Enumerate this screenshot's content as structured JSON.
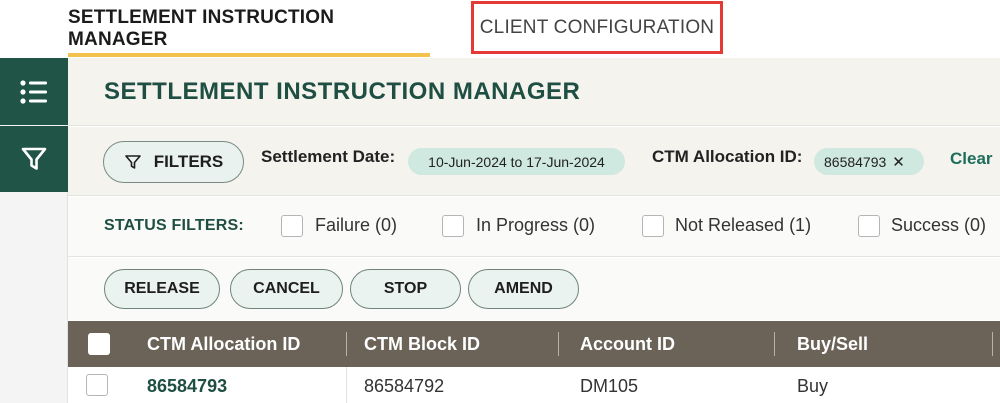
{
  "top_tabs": {
    "active": "SETTLEMENT INSTRUCTION MANAGER",
    "other": "CLIENT CONFIGURATION"
  },
  "sidebar": {
    "items": [
      {
        "icon": "list-icon"
      },
      {
        "icon": "filter-funnel-icon"
      }
    ]
  },
  "main": {
    "title": "SETTLEMENT INSTRUCTION MANAGER"
  },
  "filters": {
    "button_label": "FILTERS",
    "settlement_date_label": "Settlement Date:",
    "settlement_date_value": "10-Jun-2024 to 17-Jun-2024",
    "allocation_label": "CTM Allocation ID:",
    "allocation_value": "86584793",
    "clear_label": "Clear"
  },
  "status_filters": {
    "label": "STATUS FILTERS:",
    "items": [
      {
        "label": "Failure (0)",
        "checked": false
      },
      {
        "label": "In Progress (0)",
        "checked": false
      },
      {
        "label": "Not Released (1)",
        "checked": false
      },
      {
        "label": "Success (0)",
        "checked": false
      }
    ]
  },
  "actions": [
    "RELEASE",
    "CANCEL",
    "STOP",
    "AMEND"
  ],
  "table": {
    "columns": [
      "CTM Allocation ID",
      "CTM Block ID",
      "Account ID",
      "Buy/Sell"
    ],
    "rows": [
      {
        "allocation_id": "86584793",
        "block_id": "86584792",
        "account_id": "DM105",
        "buy_sell": "Buy"
      }
    ]
  },
  "colors": {
    "brand_green": "#1f5446",
    "title_green": "#1f4e43",
    "active_tab_underline": "#f2c14e",
    "highlight_border": "#e53935",
    "chip_bg": "#cfe8e0",
    "table_header_bg": "#6b6358"
  }
}
